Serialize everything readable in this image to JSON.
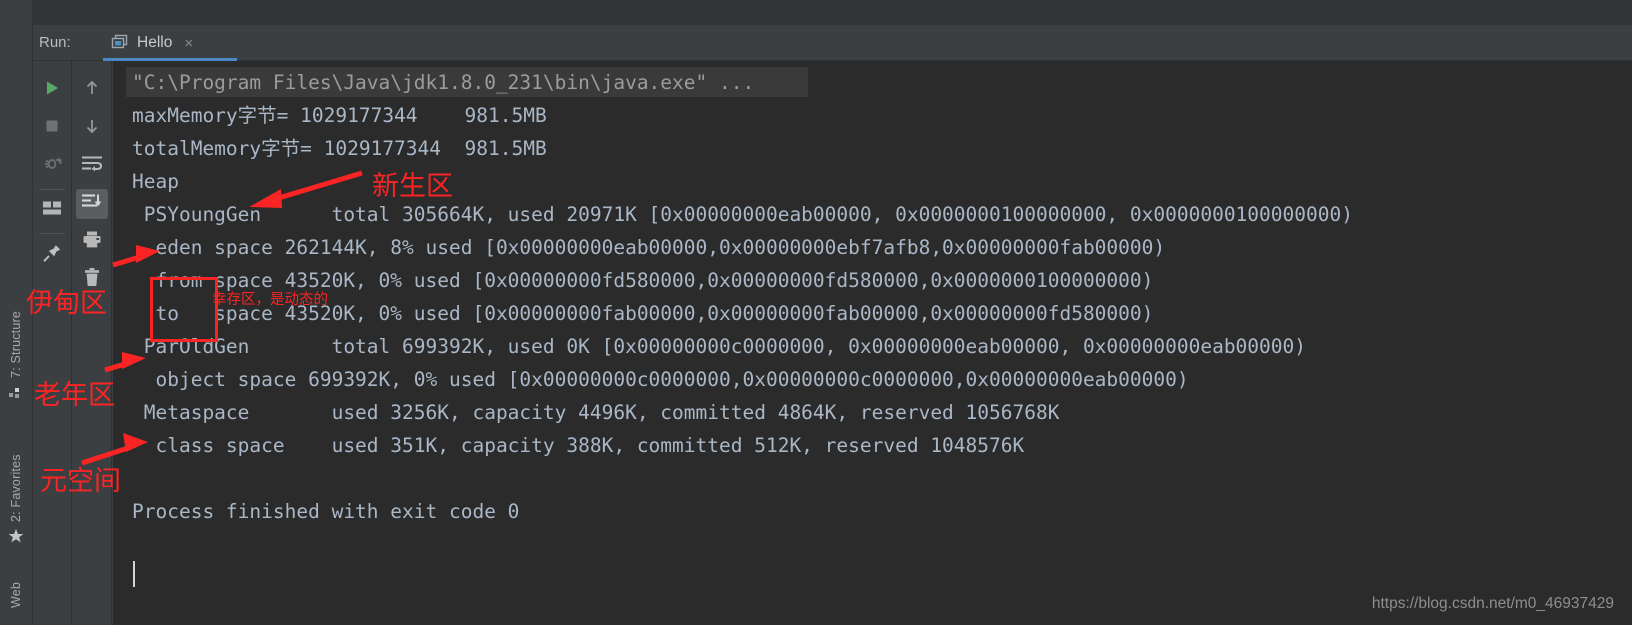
{
  "window": {
    "run_label": "Run:",
    "tab": {
      "title": "Hello",
      "close": "×",
      "icon": "run-configuration-icon"
    }
  },
  "left_rail": {
    "items": [
      {
        "label": "7: Structure",
        "icon": "structure-icon"
      },
      {
        "label": "2: Favorites",
        "icon": "star-icon"
      },
      {
        "label": "Web",
        "icon": "web-icon"
      }
    ]
  },
  "toolbar_left": {
    "buttons": [
      {
        "name": "rerun-button",
        "icon": "play-icon",
        "color": "#59a869",
        "enabled": true
      },
      {
        "name": "stop-button",
        "icon": "stop-square-icon",
        "color": "#787878",
        "enabled": false
      },
      {
        "name": "rerun-failed-tests-button",
        "icon": "bug-rerun-icon",
        "color": "#787878",
        "enabled": false
      },
      {
        "name": "toggle-layout-button",
        "icon": "layout-icon",
        "color": "#b0b0b0",
        "enabled": true
      },
      {
        "name": "pin-tab-button",
        "icon": "pin-icon",
        "color": "#b0b0b0",
        "enabled": true
      }
    ]
  },
  "toolbar_right": {
    "buttons": [
      {
        "name": "up-button",
        "icon": "arrow-up-icon",
        "color": "#9a9a9a",
        "selected": false
      },
      {
        "name": "down-button",
        "icon": "arrow-down-icon",
        "color": "#9a9a9a",
        "selected": false
      },
      {
        "name": "soft-wrap-button",
        "icon": "soft-wrap-icon",
        "color": "#b8b8b8",
        "selected": false
      },
      {
        "name": "scroll-to-end-button",
        "icon": "scroll-to-end-icon",
        "color": "#d0d0d0",
        "selected": true
      },
      {
        "name": "print-button",
        "icon": "printer-icon",
        "color": "#b8b8b8",
        "selected": false
      },
      {
        "name": "clear-all-button",
        "icon": "trash-icon",
        "color": "#b8b8b8",
        "selected": false
      }
    ]
  },
  "console": {
    "lines": [
      "\"C:\\Program Files\\Java\\jdk1.8.0_231\\bin\\java.exe\" ...",
      "maxMemory字节= 1029177344    981.5MB",
      "totalMemory字节= 1029177344  981.5MB",
      "Heap",
      " PSYoungGen      total 305664K, used 20971K [0x00000000eab00000, 0x0000000100000000, 0x0000000100000000)",
      "  eden space 262144K, 8% used [0x00000000eab00000,0x00000000ebf7afb8,0x00000000fab00000)",
      "  from space 43520K, 0% used [0x00000000fd580000,0x00000000fd580000,0x0000000100000000)",
      "  to   space 43520K, 0% used [0x00000000fab00000,0x00000000fab00000,0x00000000fd580000)",
      " ParOldGen       total 699392K, used 0K [0x00000000c0000000, 0x00000000eab00000, 0x00000000eab00000)",
      "  object space 699392K, 0% used [0x00000000c0000000,0x00000000c0000000,0x00000000eab00000)",
      " Metaspace       used 3256K, capacity 4496K, committed 4864K, reserved 1056768K",
      "  class space    used 351K, capacity 388K, committed 512K, reserved 1048576K",
      "",
      "Process finished with exit code 0"
    ],
    "watermark": "https://blog.csdn.net/m0_46937429"
  },
  "annotations": {
    "color": "#fb2424",
    "labels": [
      {
        "text": "新生区",
        "name": "annotation-young-generation"
      },
      {
        "text": "伊甸区",
        "name": "annotation-eden-space"
      },
      {
        "text": "幸存区，是动态的",
        "name": "annotation-survivor-space"
      },
      {
        "text": "老年区",
        "name": "annotation-old-generation"
      },
      {
        "text": "元空间",
        "name": "annotation-metaspace"
      }
    ]
  }
}
